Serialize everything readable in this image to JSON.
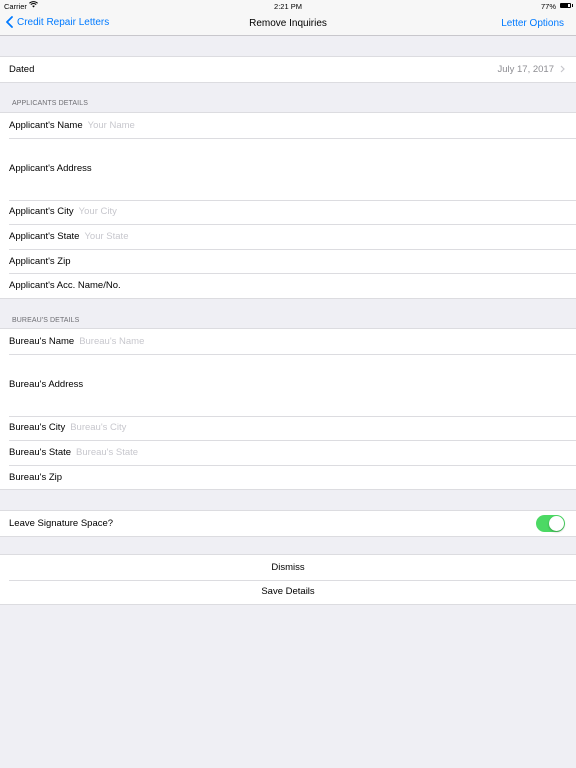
{
  "status": {
    "carrier": "Carrier",
    "time": "2:21 PM",
    "battery": "77%"
  },
  "nav": {
    "back_label": "Credit Repair Letters",
    "title": "Remove Inquiries",
    "right_label": "Letter Options"
  },
  "dated": {
    "label": "Dated",
    "value": "July 17, 2017"
  },
  "applicant": {
    "header": "APPLICANTS DETAILS",
    "name_label": "Applicant's Name",
    "name_placeholder": "Your Name",
    "address_label": "Applicant's Address",
    "city_label": "Applicant's City",
    "city_placeholder": "Your City",
    "state_label": "Applicant's State",
    "state_placeholder": "Your State",
    "zip_label": "Applicant's Zip",
    "acc_label": "Applicant's Acc. Name/No."
  },
  "bureau": {
    "header": "BUREAU'S DETAILS",
    "name_label": "Bureau's Name",
    "name_placeholder": "Bureau's Name",
    "address_label": "Bureau's Address",
    "city_label": "Bureau's City",
    "city_placeholder": "Bureau's City",
    "state_label": "Bureau's State",
    "state_placeholder": "Bureau's State",
    "zip_label": "Bureau's Zip"
  },
  "signature": {
    "label": "Leave Signature Space?",
    "enabled": true,
    "color": "#4cd964"
  },
  "actions": {
    "dismiss": "Dismiss",
    "save": "Save Details"
  },
  "colors": {
    "accent": "#007aff",
    "background": "#efeff4",
    "placeholder": "#c7c7cd"
  },
  "icons": {
    "back": "chevron-left-icon",
    "disclosure": "chevron-right-icon",
    "wifi": "wifi-icon",
    "battery": "battery-icon"
  }
}
